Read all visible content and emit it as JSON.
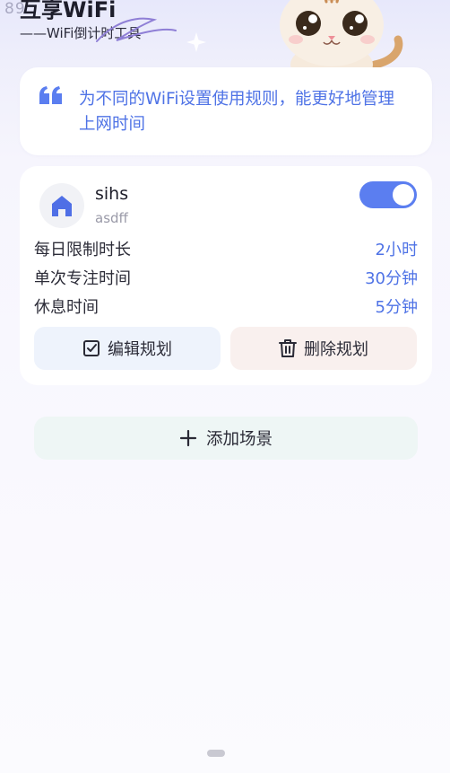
{
  "status_bar": {
    "time": "89"
  },
  "header": {
    "title": "互享WiFi",
    "subtitle": "——WiFi倒计时工具"
  },
  "tip": {
    "icon": "quote-icon",
    "text": "为不同的WiFi设置使用规则，能更好地管理上网时间"
  },
  "scene": {
    "icon": "home-icon",
    "name": "sihs",
    "description": "asdff",
    "enabled": true,
    "rules": [
      {
        "label": "每日限制时长",
        "value": "2小时"
      },
      {
        "label": "单次专注时间",
        "value": "30分钟"
      },
      {
        "label": "休息时间",
        "value": "5分钟"
      }
    ],
    "edit_label": "编辑规划",
    "delete_label": "删除规划"
  },
  "add_scene_label": "添加场景",
  "colors": {
    "accent": "#5b7ef0",
    "accent_text": "#4f73e6",
    "edit_bg": "#eef3fc",
    "delete_bg": "#f9f0ee",
    "add_bg": "#eef6f5"
  }
}
